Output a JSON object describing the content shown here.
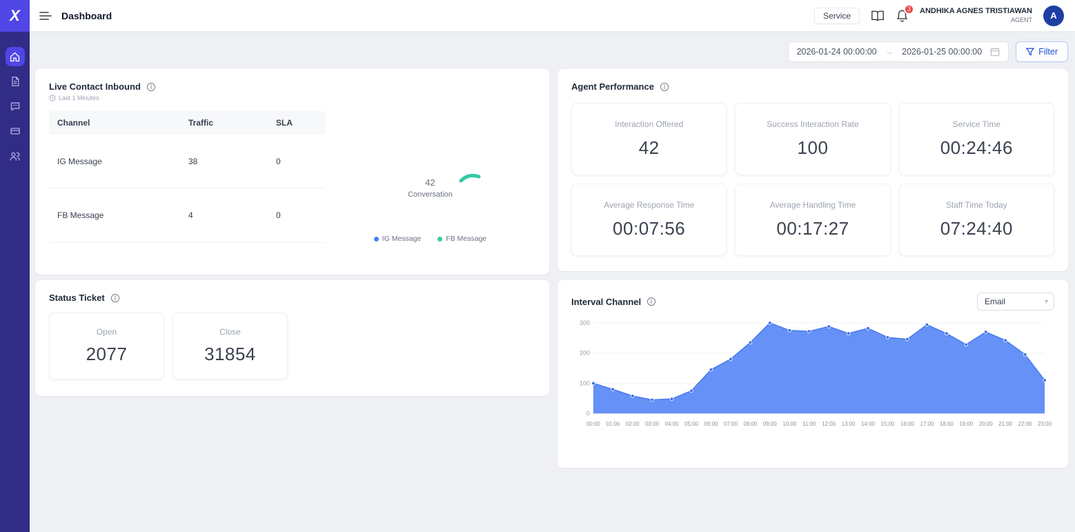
{
  "sidebar": {
    "logo": "X",
    "items": [
      {
        "name": "home",
        "active": true
      },
      {
        "name": "documents",
        "active": false
      },
      {
        "name": "messages",
        "active": false
      },
      {
        "name": "tickets",
        "active": false
      },
      {
        "name": "users",
        "active": false
      }
    ]
  },
  "header": {
    "title": "Dashboard",
    "service_label": "Service",
    "notification_count": "3",
    "user_name": "ANDHIKA AGNES TRISTIAWAN",
    "user_role": "AGENT",
    "avatar_initial": "A"
  },
  "filter_bar": {
    "date_start": "2026-01-24 00:00:00",
    "date_end": "2026-01-25 00:00:00",
    "arrow": "→",
    "filter_label": "Filter"
  },
  "live_contact": {
    "title": "Live Contact Inbound",
    "subtitle": "Last 1 Minutes",
    "table": {
      "headers": [
        "Channel",
        "Traffic",
        "SLA"
      ],
      "rows": [
        [
          "IG Message",
          "38",
          "0"
        ],
        [
          "FB Message",
          "4",
          "0"
        ]
      ]
    },
    "donut": {
      "center_value": "42",
      "center_label": "Conversation",
      "legend": [
        {
          "label": "IG Message",
          "color": "#4285f4"
        },
        {
          "label": "FB Message",
          "color": "#34c9a3"
        }
      ],
      "chart_data": {
        "type": "pie",
        "categories": [
          "IG Message",
          "FB Message"
        ],
        "values": [
          38,
          4
        ],
        "total": 42
      }
    }
  },
  "agent_performance": {
    "title": "Agent Performance",
    "stats": [
      {
        "label": "Interaction Offered",
        "value": "42"
      },
      {
        "label": "Success Interaction Rate",
        "value": "100"
      },
      {
        "label": "Service Time",
        "value": "00:24:46"
      },
      {
        "label": "Average Response Time",
        "value": "00:07:56"
      },
      {
        "label": "Average Handling Time",
        "value": "00:17:27"
      },
      {
        "label": "Staff Time Today",
        "value": "07:24:40"
      }
    ]
  },
  "status_ticket": {
    "title": "Status Ticket",
    "stats": [
      {
        "label": "Open",
        "value": "2077"
      },
      {
        "label": "Close",
        "value": "31854"
      }
    ]
  },
  "interval_channel": {
    "title": "Interval Channel",
    "dropdown_value": "Email",
    "chart_data": {
      "type": "area",
      "x": [
        "00:00",
        "01:00",
        "02:00",
        "03:00",
        "04:00",
        "05:00",
        "06:00",
        "07:00",
        "08:00",
        "09:00",
        "10:00",
        "11:00",
        "12:00",
        "13:00",
        "14:00",
        "15:00",
        "16:00",
        "17:00",
        "18:00",
        "19:00",
        "20:00",
        "21:00",
        "22:00",
        "23:00"
      ],
      "values": [
        100,
        80,
        58,
        45,
        48,
        75,
        145,
        180,
        235,
        300,
        275,
        272,
        288,
        265,
        282,
        252,
        246,
        294,
        265,
        228,
        270,
        242,
        195,
        110
      ],
      "title": "Interval Channel",
      "xlabel": "",
      "ylabel": "",
      "ylim": [
        0,
        300
      ],
      "yticks": [
        0,
        100,
        200,
        300
      ],
      "grid": true,
      "area_color": "#5e8bf5",
      "line_color": "#4678ee",
      "dot_color": "#3f6fe4"
    }
  }
}
